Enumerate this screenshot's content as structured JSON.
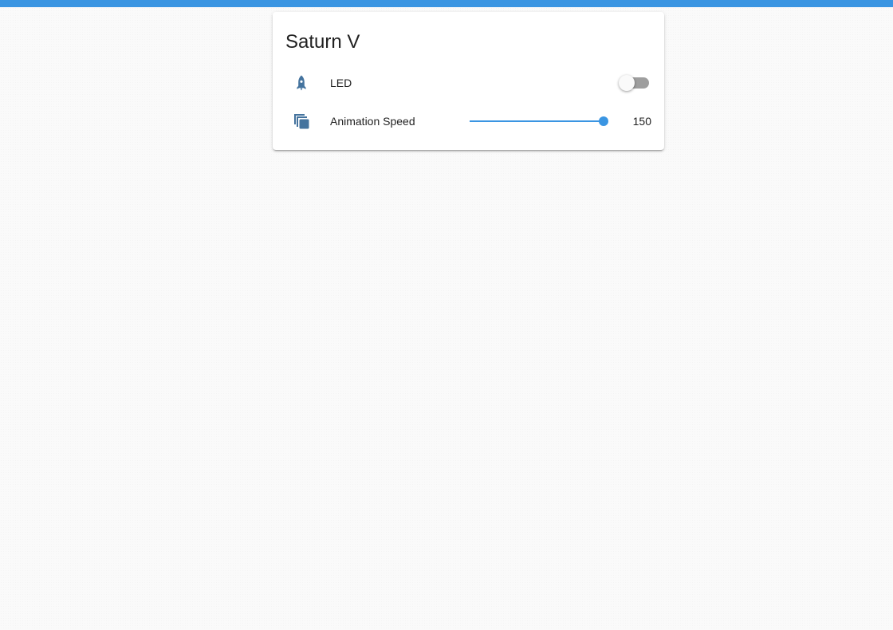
{
  "card": {
    "title": "Saturn V",
    "rows": [
      {
        "icon": "rocket-icon",
        "label": "LED",
        "control": "toggle",
        "on": false
      },
      {
        "icon": "animation-icon",
        "label": "Animation Speed",
        "control": "slider",
        "value": "150",
        "fill_fraction": 1.0
      }
    ]
  },
  "colors": {
    "accent": "#3a95e2",
    "icon": "#44739e",
    "toggle_off_track": "#9e9e9e",
    "toggle_off_thumb": "#fafafa",
    "text": "#212121"
  }
}
